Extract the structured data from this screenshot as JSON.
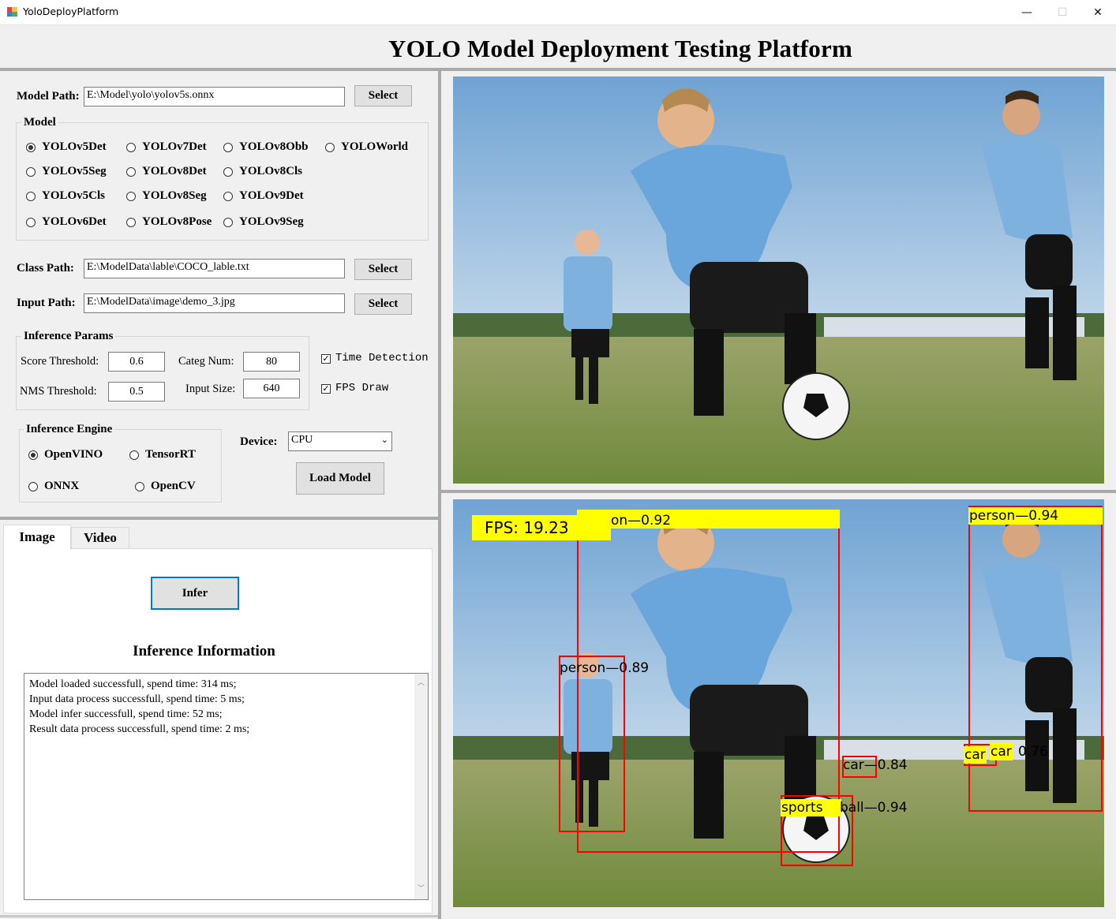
{
  "window": {
    "title": "YoloDeployPlatform",
    "minimize": "—",
    "maximize": "☐",
    "close": "✕"
  },
  "header": {
    "title": "YOLO Model Deployment Testing Platform"
  },
  "model_path": {
    "label": "Model Path:",
    "value": "E:\\Model\\yolo\\yolov5s.onnx",
    "button": "Select"
  },
  "model_group": {
    "title": "Model",
    "selected": "YOLOv5Det",
    "options": [
      "YOLOv5Det",
      "YOLOv7Det",
      "YOLOv8Obb",
      "YOLOWorld",
      "YOLOv5Seg",
      "YOLOv8Det",
      "YOLOv8Cls",
      "YOLOv5Cls",
      "YOLOv8Seg",
      "YOLOv9Det",
      "YOLOv6Det",
      "YOLOv8Pose",
      "YOLOv9Seg"
    ]
  },
  "class_path": {
    "label": "Class Path:",
    "value": "E:\\ModelData\\lable\\COCO_lable.txt",
    "button": "Select"
  },
  "input_path": {
    "label": "Input Path:",
    "value": "E:\\ModelData\\image\\demo_3.jpg",
    "button": "Select"
  },
  "params": {
    "title": "Inference Params",
    "score_label": "Score Threshold:",
    "score_value": "0.6",
    "nms_label": "NMS Threshold:",
    "nms_value": "0.5",
    "categ_label": "Categ Num:",
    "categ_value": "80",
    "input_size_label": "Input Size:",
    "input_size_value": "640",
    "time_detection": {
      "label": "Time Detection",
      "checked": true
    },
    "fps_draw": {
      "label": "FPS Draw",
      "checked": true
    }
  },
  "engine": {
    "title": "Inference Engine",
    "selected": "OpenVINO",
    "options": [
      "OpenVINO",
      "TensorRT",
      "ONNX",
      "OpenCV"
    ]
  },
  "device": {
    "label": "Device:",
    "value": "CPU"
  },
  "load_model_button": "Load Model",
  "tabs": [
    "Image",
    "Video"
  ],
  "active_tab": "Image",
  "infer_button": "Infer",
  "info": {
    "title": "Inference Information",
    "lines": [
      "Model loaded successfull, spend time: 314 ms;",
      "Input data process successfull, spend time: 5 ms;",
      "Model infer successfull, spend time: 52 ms;",
      "Result data process successfull, spend time: 2 ms;"
    ]
  },
  "result": {
    "fps": "FPS:  19.23",
    "labels": [
      "on—0.92",
      "person—0.94",
      "person—0.89",
      "car—0.84",
      "car",
      "car",
      "0.76",
      "sports",
      "ball—0.94"
    ]
  },
  "colors": {
    "box": "#ff0000",
    "label_bg": "#ffff00",
    "sky": "#8db6dc",
    "grass": "#7f9a4b"
  }
}
